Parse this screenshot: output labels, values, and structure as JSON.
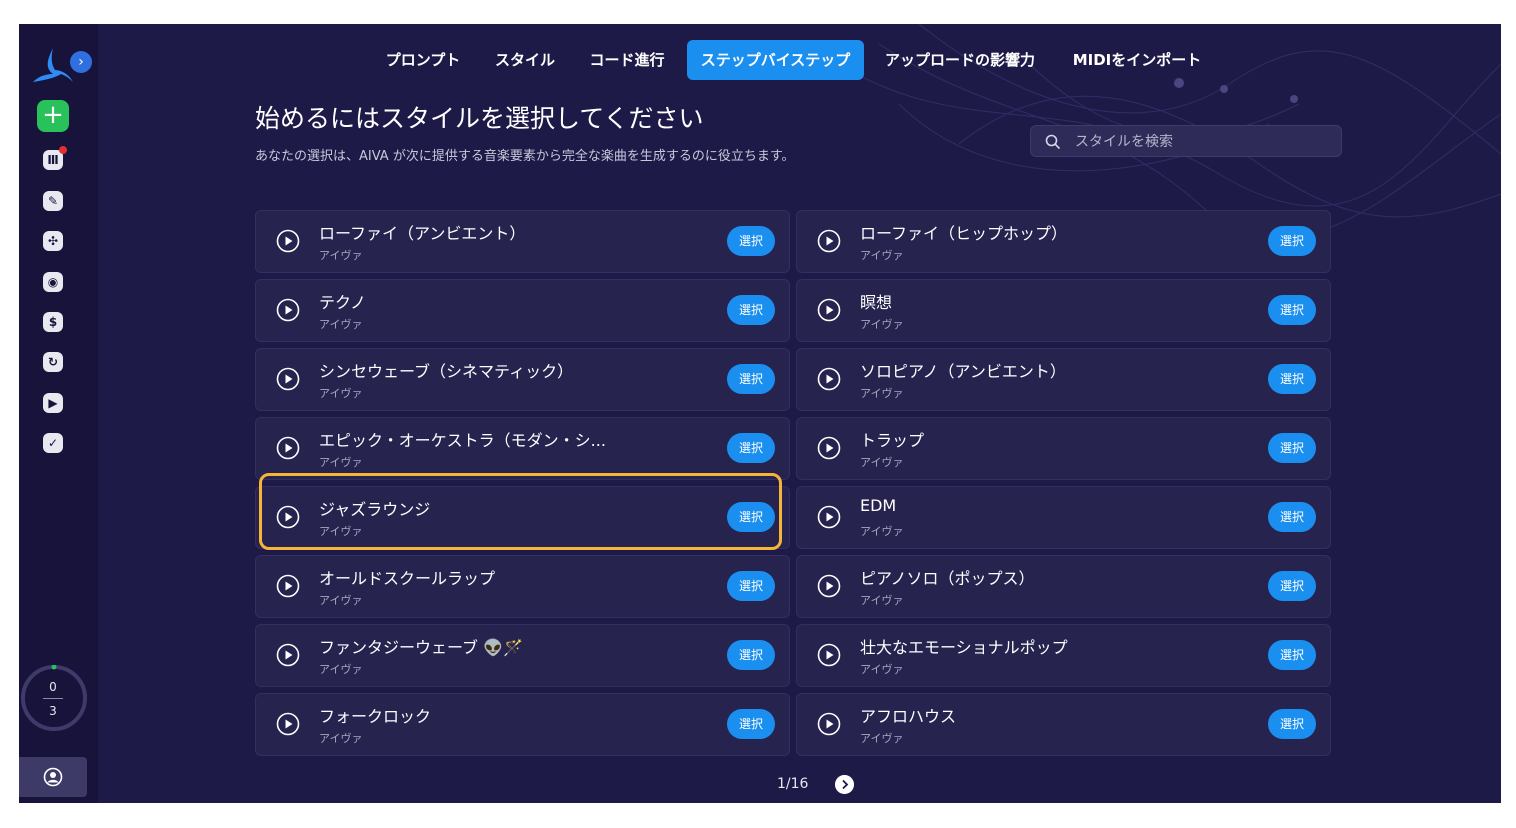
{
  "sidebar": {
    "credits_used": "0",
    "credits_total": "3"
  },
  "tabs": [
    {
      "label": "プロンプト"
    },
    {
      "label": "スタイル"
    },
    {
      "label": "コード進行"
    },
    {
      "label": "ステップバイステップ",
      "active": true
    },
    {
      "label": "アップロードの影響力"
    },
    {
      "label": "MIDIをインポート"
    }
  ],
  "header": {
    "title": "始めるにはスタイルを選択してください",
    "subtitle": "あなたの選択は、AIVA が次に提供する音楽要素から完全な楽曲を生成するのに役立ちます。"
  },
  "search": {
    "placeholder": "スタイルを検索"
  },
  "styles": [
    {
      "name": "ローファイ（アンビエント）",
      "author": "アイヴァ",
      "select": "選択"
    },
    {
      "name": "ローファイ（ヒップホップ）",
      "author": "アイヴァ",
      "select": "選択"
    },
    {
      "name": "テクノ",
      "author": "アイヴァ",
      "select": "選択"
    },
    {
      "name": "瞑想",
      "author": "アイヴァ",
      "select": "選択"
    },
    {
      "name": "シンセウェーブ（シネマティック）",
      "author": "アイヴァ",
      "select": "選択"
    },
    {
      "name": "ソロピアノ（アンビエント）",
      "author": "アイヴァ",
      "select": "選択"
    },
    {
      "name": "エピック・オーケストラ（モダン・シ...",
      "author": "アイヴァ",
      "select": "選択"
    },
    {
      "name": "トラップ",
      "author": "アイヴァ",
      "select": "選択"
    },
    {
      "name": "ジャズラウンジ",
      "author": "アイヴァ",
      "select": "選択",
      "highlighted": true
    },
    {
      "name": "EDM",
      "author": "アイヴァ",
      "select": "選択"
    },
    {
      "name": "オールドスクールラップ",
      "author": "アイヴァ",
      "select": "選択"
    },
    {
      "name": "ピアノソロ（ポップス）",
      "author": "アイヴァ",
      "select": "選択"
    },
    {
      "name": "ファンタジーウェーブ 👽🪄",
      "author": "アイヴァ",
      "select": "選択"
    },
    {
      "name": "壮大なエモーショナルポップ",
      "author": "アイヴァ",
      "select": "選択"
    },
    {
      "name": "フォークロック",
      "author": "アイヴァ",
      "select": "選択"
    },
    {
      "name": "アフロハウス",
      "author": "アイヴァ",
      "select": "選択"
    }
  ],
  "pagination": {
    "label": "1/16"
  },
  "colors": {
    "accent": "#1a8ff0",
    "highlight": "#f7b538",
    "new": "#29c15a",
    "background": "#1e1a48"
  }
}
